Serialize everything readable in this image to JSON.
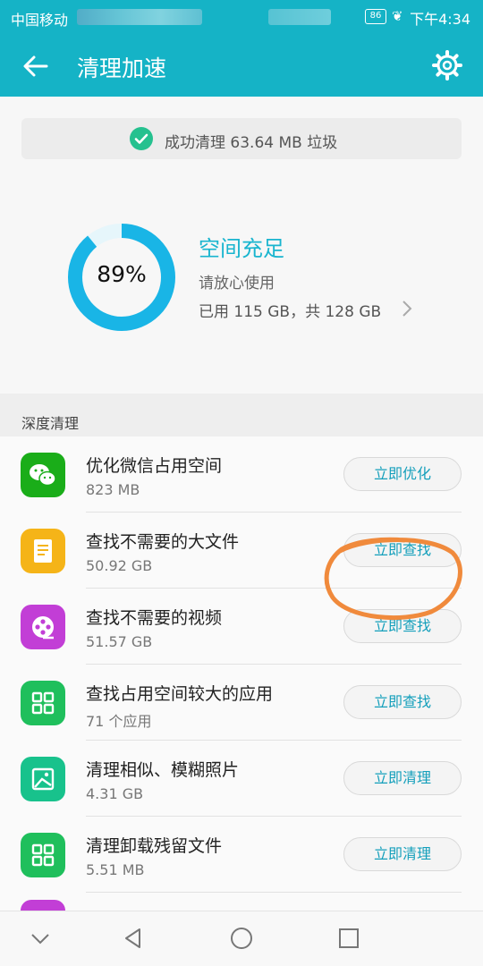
{
  "status_bar": {
    "carrier": "中国移动",
    "battery": "86",
    "time": "下午4:34"
  },
  "app_bar": {
    "title": "清理加速"
  },
  "toast": {
    "message": "成功清理 63.64 MB 垃圾"
  },
  "storage": {
    "percent_used": 89,
    "percent_label": "89%",
    "status": "空间充足",
    "hint": "请放心使用",
    "usage": "已用 115 GB，共 128 GB"
  },
  "deep_clean": {
    "section_title": "深度清理",
    "items": [
      {
        "title": "优化微信占用空间",
        "subtitle": "823 MB",
        "button": "立即优化",
        "icon": "wechat-icon",
        "color": "#1aad19"
      },
      {
        "title": "查找不需要的大文件",
        "subtitle": "50.92 GB",
        "button": "立即查找",
        "icon": "document-icon",
        "color": "#f5b418"
      },
      {
        "title": "查找不需要的视频",
        "subtitle": "51.57 GB",
        "button": "立即查找",
        "icon": "film-reel-icon",
        "color": "#c23ed6"
      },
      {
        "title": "查找占用空间较大的应用",
        "subtitle": "71 个应用",
        "button": "立即查找",
        "icon": "app-grid-icon",
        "color": "#1fbf5c"
      },
      {
        "title": "清理相似、模糊照片",
        "subtitle": "4.31 GB",
        "button": "立即清理",
        "icon": "photo-icon",
        "color": "#18c28c"
      },
      {
        "title": "清理卸载残留文件",
        "subtitle": "5.51 MB",
        "button": "立即清理",
        "icon": "app-grid-icon",
        "color": "#1fbf5c"
      }
    ]
  },
  "colors": {
    "accent": "#15b3c6",
    "ring": "#19b5e6",
    "annotation": "#f08a3c"
  }
}
